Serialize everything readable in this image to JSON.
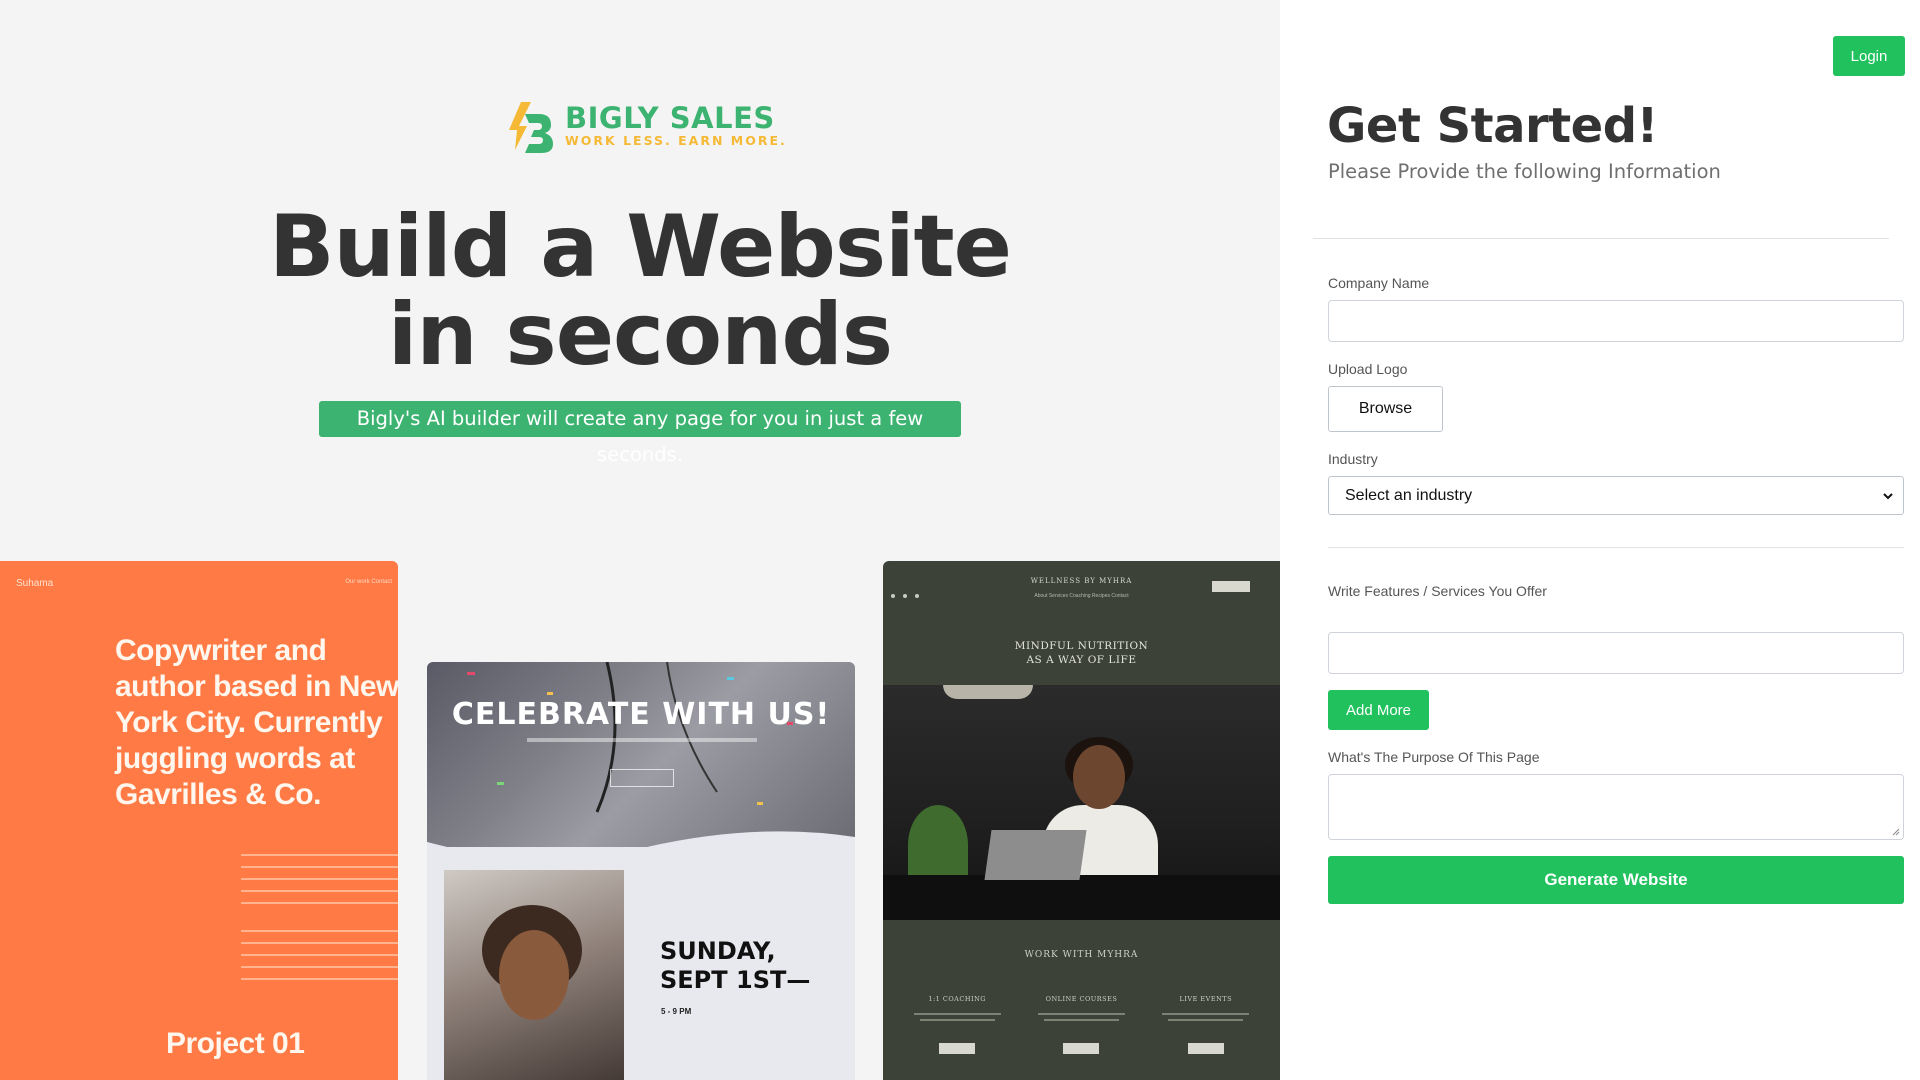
{
  "hero": {
    "logo": {
      "name": "BIGLY SALES",
      "tagline": "WORK LESS. EARN MORE."
    },
    "headline_line1": "Build a Website",
    "headline_line2": "in seconds",
    "subheadline": "Bigly's AI builder will create any page for you in just a few seconds.",
    "brand_color": "#3cb371",
    "accent_color": "#f5b935"
  },
  "previews": {
    "copywriter": {
      "brand": "Suhama",
      "nav": "Our work    Contact",
      "heading": "Copywriter and author based in New York City. Currently juggling words at Gavrilles & Co.",
      "project": "Project 01",
      "color": "#ff7a45"
    },
    "party": {
      "title": "CELEBRATE WITH US!",
      "date_line1": "SUNDAY,",
      "date_line2": "SEPT 1ST—",
      "time": "5 - 9 PM"
    },
    "wellness": {
      "brand": "WELLNESS BY MYHRA",
      "nav": "About    Services    Coaching    Recipes    Contact",
      "heading_line1": "MINDFUL NUTRITION",
      "heading_line2": "AS A WAY OF LIFE",
      "work": "WORK WITH MYHRA",
      "columns": [
        "1:1 COACHING",
        "ONLINE COURSES",
        "LIVE EVENTS"
      ],
      "color": "#3c4237"
    }
  },
  "form": {
    "login_label": "Login",
    "title": "Get Started!",
    "subtitle": "Please Provide the following Information",
    "company_name_label": "Company Name",
    "company_name_value": "",
    "upload_logo_label": "Upload Logo",
    "browse_label": "Browse",
    "industry_label": "Industry",
    "industry_selected": "Select an industry",
    "features_label": "Write Features / Services You Offer",
    "features_value": "",
    "add_more_label": "Add More",
    "purpose_label": "What's The Purpose Of This Page",
    "purpose_value": "",
    "generate_label": "Generate Website",
    "button_color": "#21c15e"
  }
}
